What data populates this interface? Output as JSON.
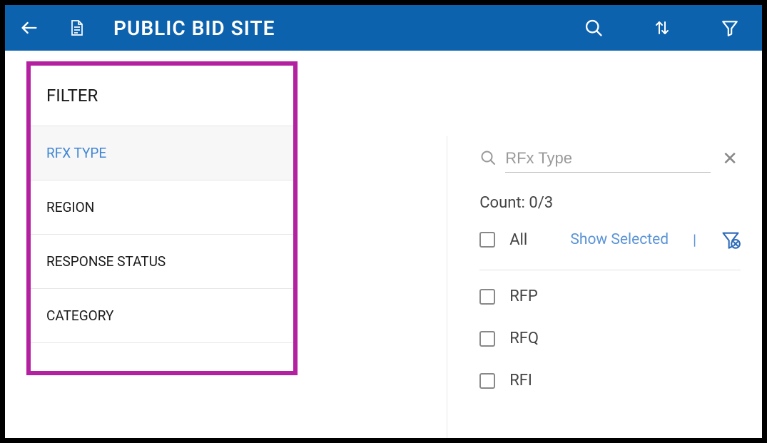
{
  "header": {
    "title": "PUBLIC BID SITE"
  },
  "sidebar": {
    "header": "FILTER",
    "items": [
      {
        "label": "RFX TYPE",
        "selected": true
      },
      {
        "label": "REGION",
        "selected": false
      },
      {
        "label": "RESPONSE STATUS",
        "selected": false
      },
      {
        "label": "CATEGORY",
        "selected": false
      }
    ]
  },
  "detail": {
    "search_placeholder": "RFx Type",
    "count_label": "Count: 0/3",
    "all_label": "All",
    "show_selected_label": "Show Selected",
    "options": [
      {
        "label": "RFP"
      },
      {
        "label": "RFQ"
      },
      {
        "label": "RFI"
      }
    ]
  }
}
